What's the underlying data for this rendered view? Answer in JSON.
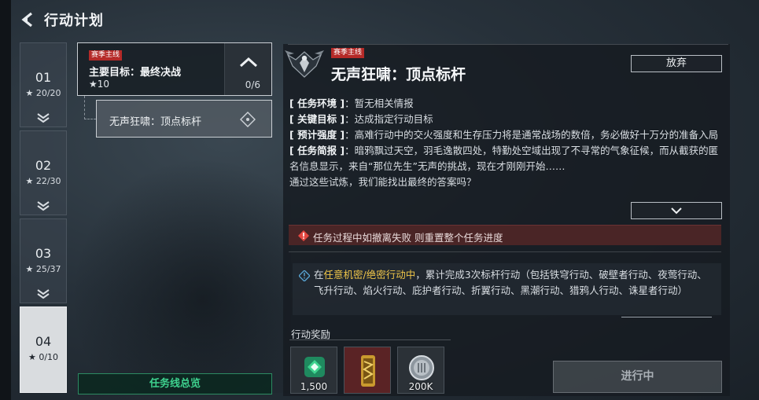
{
  "header": {
    "title": "行动计划",
    "back_icon": "back-arrow-icon"
  },
  "chapters": [
    {
      "num": "01",
      "stars": "20/20",
      "active": false
    },
    {
      "num": "02",
      "stars": "22/30",
      "active": false
    },
    {
      "num": "03",
      "stars": "25/37",
      "active": false
    },
    {
      "num": "04",
      "stars": "0/10",
      "active": true
    }
  ],
  "mission_tree": {
    "main": {
      "tag": "赛季主线",
      "name": "主要目标：最终决战",
      "stars": "10",
      "progress": "0/6"
    },
    "sub": {
      "name": "无声狂啸：顶点标杆"
    }
  },
  "overview_button": "任务线总览",
  "detail": {
    "tag": "赛季主线",
    "title": "无声狂啸：顶点标杆",
    "abandon_label": "放弃",
    "info": [
      {
        "label": "[ 任务环境 ]",
        "value": "暂无相关情报"
      },
      {
        "label": "[ 关键目标 ]",
        "value": "达成指定行动目标"
      },
      {
        "label": "[ 预计强度 ]",
        "value": "高难行动中的交火强度和生存压力将是通常战场的数倍，务必做好十万分的准备入局"
      },
      {
        "label": "[ 任务简报 ]",
        "value": "暗鸦飘过天空，羽毛逸散四处，特勤处空域出现了不寻常的气象征候，而从截获的匿名信息显示，来自“那位先生”无声的挑战，现在才刚刚开始……"
      },
      {
        "label": "",
        "value": "通过这些试炼，我们能找出最终的答案吗？"
      }
    ],
    "warning": "任务过程中如撤离失败 则重置整个任务进度",
    "objective": {
      "prefix": "在",
      "highlight": "任意机密/绝密行动中",
      "suffix": "，累计完成3次标杆行动（包括铁穹行动、破壁者行动、夜莺行动、飞升行动、焰火行动、庇护者行动、折翼行动、黑潮行动、猎鸦人行动、诛星者行动）"
    },
    "rewards_title": "行动奖励",
    "rewards": [
      {
        "icon": "green-badge-icon",
        "qty": "1,500"
      },
      {
        "icon": "gold-item-icon",
        "qty": ""
      },
      {
        "icon": "silver-coin-icon",
        "qty": "200K"
      }
    ],
    "status_button": "进行中"
  },
  "colors": {
    "accent_green": "#3ed18e",
    "tag_red": "#b52a28",
    "highlight_yellow": "#f0c649",
    "warning_bg": "#4a2526"
  }
}
